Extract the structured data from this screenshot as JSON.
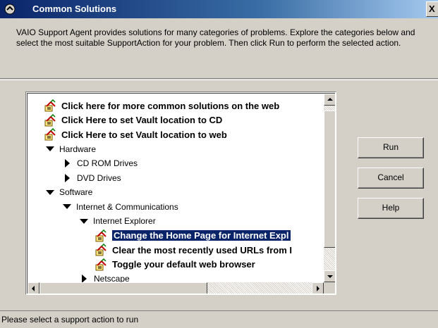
{
  "window": {
    "title": "Common Solutions",
    "close_label": "X",
    "description": "VAIO Support Agent provides solutions for many categories of problems. Explore the categories below and select the most suitable SupportAction for your problem. Then click Run to perform the selected action."
  },
  "tree": {
    "items": [
      {
        "label": "Click here for more common solutions on the web",
        "type": "action",
        "level": 0,
        "icon": "support-action-icon"
      },
      {
        "label": "Click Here to set Vault location to CD",
        "type": "action",
        "level": 0,
        "icon": "support-action-icon"
      },
      {
        "label": "Click Here to set Vault location to web",
        "type": "action",
        "level": 0,
        "icon": "support-action-icon"
      },
      {
        "label": "Hardware",
        "type": "expanded",
        "level": 0,
        "icon": "expanded-arrow-icon"
      },
      {
        "label": "CD ROM Drives",
        "type": "collapsed",
        "level": 1,
        "icon": "collapsed-arrow-icon"
      },
      {
        "label": "DVD Drives",
        "type": "collapsed",
        "level": 1,
        "icon": "collapsed-arrow-icon"
      },
      {
        "label": "Software",
        "type": "expanded",
        "level": 0,
        "icon": "expanded-arrow-icon"
      },
      {
        "label": "Internet & Communications",
        "type": "expanded",
        "level": 1,
        "icon": "expanded-arrow-icon"
      },
      {
        "label": "Internet Explorer",
        "type": "expanded",
        "level": 2,
        "icon": "expanded-arrow-icon"
      },
      {
        "label": "Change the Home Page for Internet Expl",
        "type": "action",
        "level": 3,
        "icon": "support-action-icon",
        "selected": true
      },
      {
        "label": "Clear the most recently used URLs from I",
        "type": "action",
        "level": 3,
        "icon": "support-action-icon"
      },
      {
        "label": "Toggle your default web browser",
        "type": "action",
        "level": 3,
        "icon": "support-action-icon"
      },
      {
        "label": "Netscape",
        "type": "collapsed",
        "level": 2,
        "icon": "collapsed-arrow-icon"
      }
    ]
  },
  "buttons": {
    "run": "Run",
    "cancel": "Cancel",
    "help": "Help"
  },
  "status": {
    "text": "Please select a support action to run"
  },
  "colors": {
    "titlebar_start": "#0a246a",
    "titlebar_end": "#a6caf0",
    "dialog_face": "#d4d0c8",
    "selection": "#0a246a"
  }
}
